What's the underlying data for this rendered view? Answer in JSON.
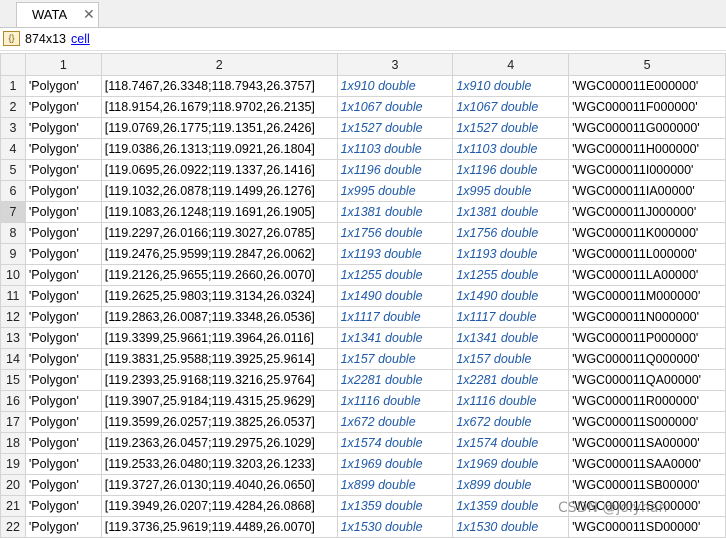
{
  "tab": {
    "label": "WATA",
    "close_glyph": "✕"
  },
  "info": {
    "size": "874x13",
    "class_name": "cell",
    "icon": "braces-icon",
    "icon_glyph": "{}"
  },
  "columns": [
    "",
    "1",
    "2",
    "3",
    "4",
    "5"
  ],
  "selected_row": "7",
  "rows": [
    [
      "1",
      "'Polygon'",
      "[118.7467,26.3348;118.7943,26.3757]",
      "1x910 double",
      "1x910 double",
      "'WGC000011E000000'"
    ],
    [
      "2",
      "'Polygon'",
      "[118.9154,26.1679;118.9702,26.2135]",
      "1x1067 double",
      "1x1067 double",
      "'WGC000011F000000'"
    ],
    [
      "3",
      "'Polygon'",
      "[119.0769,26.1775;119.1351,26.2426]",
      "1x1527 double",
      "1x1527 double",
      "'WGC000011G000000'"
    ],
    [
      "4",
      "'Polygon'",
      "[119.0386,26.1313;119.0921,26.1804]",
      "1x1103 double",
      "1x1103 double",
      "'WGC000011H000000'"
    ],
    [
      "5",
      "'Polygon'",
      "[119.0695,26.0922;119.1337,26.1416]",
      "1x1196 double",
      "1x1196 double",
      "'WGC000011I000000'"
    ],
    [
      "6",
      "'Polygon'",
      "[119.1032,26.0878;119.1499,26.1276]",
      "1x995 double",
      "1x995 double",
      "'WGC000011IA00000'"
    ],
    [
      "7",
      "'Polygon'",
      "[119.1083,26.1248;119.1691,26.1905]",
      "1x1381 double",
      "1x1381 double",
      "'WGC000011J000000'"
    ],
    [
      "8",
      "'Polygon'",
      "[119.2297,26.0166;119.3027,26.0785]",
      "1x1756 double",
      "1x1756 double",
      "'WGC000011K000000'"
    ],
    [
      "9",
      "'Polygon'",
      "[119.2476,25.9599;119.2847,26.0062]",
      "1x1193 double",
      "1x1193 double",
      "'WGC000011L000000'"
    ],
    [
      "10",
      "'Polygon'",
      "[119.2126,25.9655;119.2660,26.0070]",
      "1x1255 double",
      "1x1255 double",
      "'WGC000011LA00000'"
    ],
    [
      "11",
      "'Polygon'",
      "[119.2625,25.9803;119.3134,26.0324]",
      "1x1490 double",
      "1x1490 double",
      "'WGC000011M000000'"
    ],
    [
      "12",
      "'Polygon'",
      "[119.2863,26.0087;119.3348,26.0536]",
      "1x1117 double",
      "1x1117 double",
      "'WGC000011N000000'"
    ],
    [
      "13",
      "'Polygon'",
      "[119.3399,25.9661;119.3964,26.0116]",
      "1x1341 double",
      "1x1341 double",
      "'WGC000011P000000'"
    ],
    [
      "14",
      "'Polygon'",
      "[119.3831,25.9588;119.3925,25.9614]",
      "1x157 double",
      "1x157 double",
      "'WGC000011Q000000'"
    ],
    [
      "15",
      "'Polygon'",
      "[119.2393,25.9168;119.3216,25.9764]",
      "1x2281 double",
      "1x2281 double",
      "'WGC000011QA00000'"
    ],
    [
      "16",
      "'Polygon'",
      "[119.3907,25.9184;119.4315,25.9629]",
      "1x1116 double",
      "1x1116 double",
      "'WGC000011R000000'"
    ],
    [
      "17",
      "'Polygon'",
      "[119.3599,26.0257;119.3825,26.0537]",
      "1x672 double",
      "1x672 double",
      "'WGC000011S000000'"
    ],
    [
      "18",
      "'Polygon'",
      "[119.2363,26.0457;119.2975,26.1029]",
      "1x1574 double",
      "1x1574 double",
      "'WGC000011SA00000'"
    ],
    [
      "19",
      "'Polygon'",
      "[119.2533,26.0480;119.3203,26.1233]",
      "1x1969 double",
      "1x1969 double",
      "'WGC000011SAA0000'"
    ],
    [
      "20",
      "'Polygon'",
      "[119.3727,26.0130;119.4040,26.0650]",
      "1x899 double",
      "1x899 double",
      "'WGC000011SB00000'"
    ],
    [
      "21",
      "'Polygon'",
      "[119.3949,26.0207;119.4284,26.0868]",
      "1x1359 double",
      "1x1359 double",
      "'WGC000011SC00000'"
    ],
    [
      "22",
      "'Polygon'",
      "[119.3736,25.9619;119.4489,26.0070]",
      "1x1530 double",
      "1x1530 double",
      "'WGC000011SD00000'"
    ]
  ],
  "watermark": "CSDN @jolyhan"
}
